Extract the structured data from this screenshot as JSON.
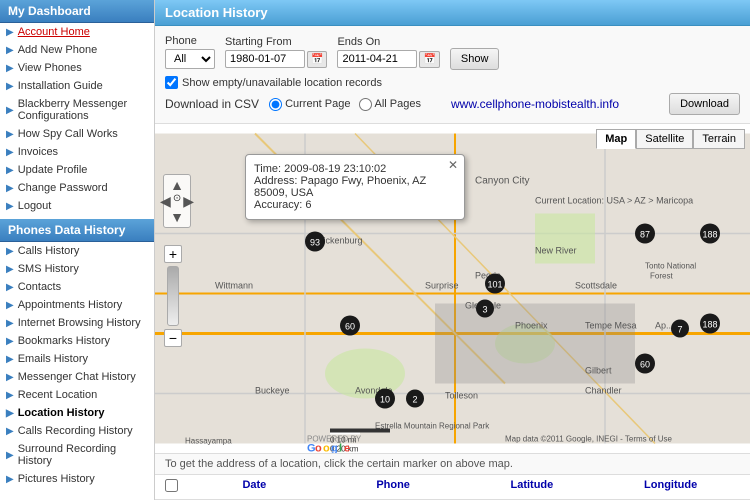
{
  "sidebar": {
    "section1_title": "My Dashboard",
    "section2_title": "Phones Data History",
    "items_top": [
      {
        "label": "Account Home",
        "type": "link"
      },
      {
        "label": "Add New Phone",
        "type": "link"
      },
      {
        "label": "View Phones",
        "type": "link"
      },
      {
        "label": "Installation Guide",
        "type": "link"
      },
      {
        "label": "Blackberry Messenger Configurations",
        "type": "text"
      },
      {
        "label": "How Spy Call Works",
        "type": "link"
      },
      {
        "label": "Invoices",
        "type": "link"
      },
      {
        "label": "Update Profile",
        "type": "link"
      },
      {
        "label": "Change Password",
        "type": "link"
      },
      {
        "label": "Logout",
        "type": "link"
      }
    ],
    "items_bottom": [
      {
        "label": "Calls History"
      },
      {
        "label": "SMS History"
      },
      {
        "label": "Contacts"
      },
      {
        "label": "Appointments History"
      },
      {
        "label": "Internet Browsing History"
      },
      {
        "label": "Bookmarks History"
      },
      {
        "label": "Emails History"
      },
      {
        "label": "Messenger Chat History"
      },
      {
        "label": "Recent Location"
      },
      {
        "label": "Location History"
      },
      {
        "label": "Calls Recording History"
      },
      {
        "label": "Surround Recording History"
      },
      {
        "label": "Pictures History"
      }
    ]
  },
  "header": {
    "title": "Location History"
  },
  "controls": {
    "phone_label": "Phone",
    "phone_value": "All",
    "starting_from_label": "Starting From",
    "starting_from_value": "1980-01-07",
    "ends_on_label": "Ends On",
    "ends_on_value": "2011-04-21",
    "show_button": "Show",
    "checkbox_label": "Show empty/unavailable location records",
    "download_csv_label": "Download in CSV",
    "current_page_label": "Current Page",
    "all_pages_label": "All Pages",
    "website": "www.cellphone-mobistealth.info",
    "download_button": "Download"
  },
  "map": {
    "tab_map": "Map",
    "tab_satellite": "Satellite",
    "tab_terrain": "Terrain",
    "popup": {
      "time": "Time: 2009-08-19 23:10:02",
      "address": "Address: Papago Fwy, Phoenix, AZ 85009, USA",
      "accuracy": "Accuracy: 6"
    },
    "google_label": "POWERED BY Google",
    "scale_label": "10 mi / 20 km",
    "map_data": "Map data ©2011 Google, INEGI -",
    "terms": "Terms of Use"
  },
  "bottom": {
    "instruction": "To get the address of a location, click the certain marker on above map."
  },
  "table_header": {
    "col_date": "Date",
    "col_phone": "Phone",
    "col_latitude": "Latitude",
    "col_longitude": "Longitude"
  }
}
